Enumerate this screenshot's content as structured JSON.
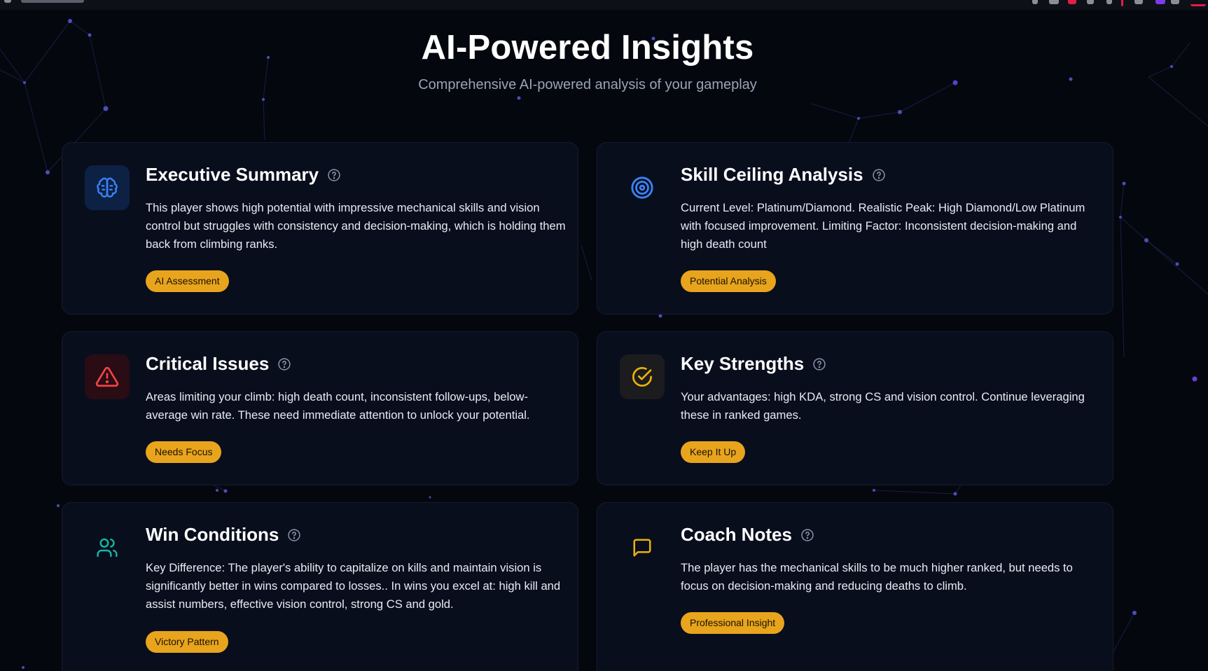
{
  "header": {
    "title": "AI-Powered Insights",
    "subtitle": "Comprehensive AI-powered analysis of your gameplay"
  },
  "colors": {
    "background": "#05070f",
    "card_background": "#0a0f1e",
    "badge": "#e8a41c",
    "brain_icon": "#3b82f6",
    "target_icon": "#3b82f6",
    "alert_icon": "#ef4444",
    "check_icon": "#eab308",
    "users_icon": "#14b8a6",
    "message_icon": "#eab308"
  },
  "cards": [
    {
      "title": "Executive Summary",
      "icon": "brain-icon",
      "text": "This player shows high potential with impressive mechanical skills and vision control but struggles with consistency and decision-making, which is holding them back from climbing ranks.",
      "badge": "AI Assessment"
    },
    {
      "title": "Skill Ceiling Analysis",
      "icon": "target-icon",
      "text": "Current Level: Platinum/Diamond. Realistic Peak: High Diamond/Low Platinum with focused improvement. Limiting Factor: Inconsistent decision-making and high death count",
      "badge": "Potential Analysis"
    },
    {
      "title": "Critical Issues",
      "icon": "alert-triangle-icon",
      "text": "Areas limiting your climb: high death count, inconsistent follow-ups, below-average win rate. These need immediate attention to unlock your potential.",
      "badge": "Needs Focus"
    },
    {
      "title": "Key Strengths",
      "icon": "check-circle-icon",
      "text": "Your advantages: high KDA, strong CS and vision control. Continue leveraging these in ranked games.",
      "badge": "Keep It Up"
    },
    {
      "title": "Win Conditions",
      "icon": "users-icon",
      "text": "Key Difference: The player's ability to capitalize on kills and maintain vision is significantly better in wins compared to losses.. In wins you excel at: high kill and assist numbers, effective vision control, strong CS and gold.",
      "badge": "Victory Pattern"
    },
    {
      "title": "Coach Notes",
      "icon": "message-square-icon",
      "text": "The player has the mechanical skills to be much higher ranked, but needs to focus on decision-making and reducing deaths to climb.",
      "badge": "Professional Insight"
    }
  ]
}
